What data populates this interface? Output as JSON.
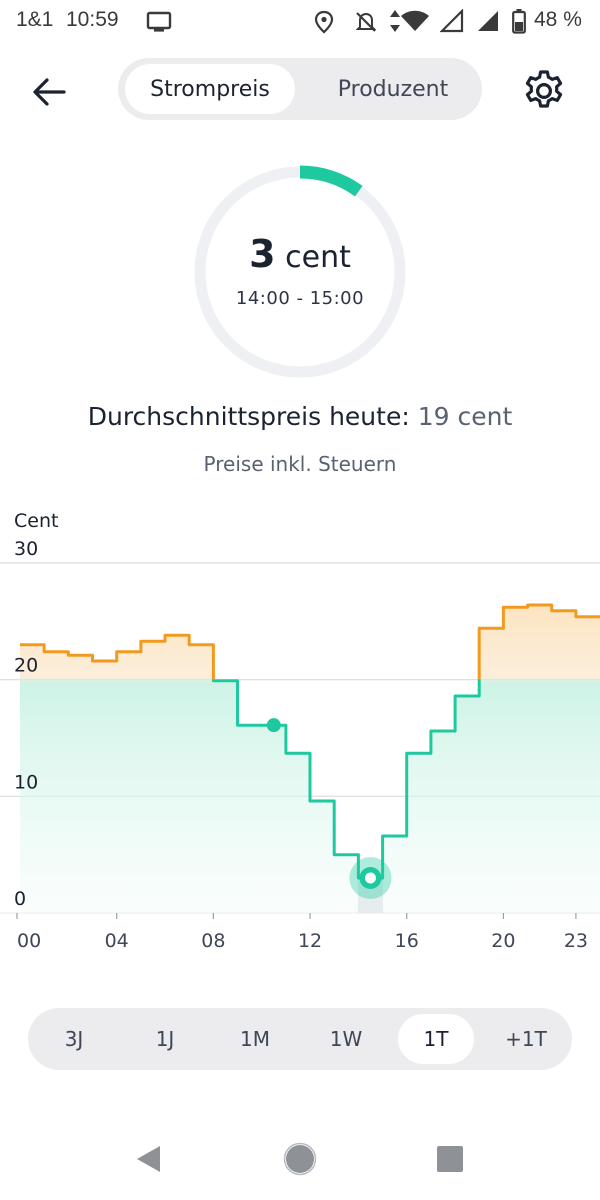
{
  "status_bar": {
    "carrier": "1&1",
    "time": "10:59",
    "battery": "48 %",
    "icons": [
      "screen-cast-icon",
      "location-icon",
      "notifications-off-icon",
      "data-arrows-icon",
      "wifi-icon",
      "signal-icon",
      "signal-icon",
      "battery-icon"
    ]
  },
  "header": {
    "back_icon": "back-arrow-icon",
    "tabs": [
      {
        "label": "Strompreis",
        "active": true
      },
      {
        "label": "Produzent",
        "active": false
      }
    ],
    "settings_icon": "gear-icon"
  },
  "gauge": {
    "value_number": "3",
    "value_unit": "cent",
    "time_range": "14:00 - 15:00",
    "level": 0.1
  },
  "summary": {
    "avg_label": "Durchschnittspreis heute:",
    "avg_value": "19 cent",
    "tax_note": "Preise inkl. Steuern"
  },
  "chart_data": {
    "type": "line",
    "ylabel": "Cent",
    "ylim": [
      0,
      30
    ],
    "yticks": [
      "0",
      "10",
      "20",
      "30"
    ],
    "xlim": [
      0,
      24
    ],
    "xticks": [
      {
        "h": 0,
        "label": "00"
      },
      {
        "h": 4,
        "label": "04"
      },
      {
        "h": 8,
        "label": "08"
      },
      {
        "h": 12,
        "label": "12"
      },
      {
        "h": 16,
        "label": "16"
      },
      {
        "h": 20,
        "label": "20"
      },
      {
        "h": 23,
        "label": "23"
      }
    ],
    "threshold": 20,
    "series": [
      {
        "x": [
          0,
          1,
          2,
          3,
          4,
          5,
          6,
          7,
          8,
          9,
          10,
          11,
          12,
          13,
          14,
          15,
          16,
          17,
          18,
          19,
          20,
          21,
          22,
          23
        ],
        "values": [
          23.0,
          22.4,
          22.1,
          21.6,
          22.4,
          23.3,
          23.8,
          23.0,
          19.9,
          16.1,
          16.1,
          13.7,
          9.6,
          5.0,
          3.0,
          6.6,
          13.7,
          15.6,
          18.6,
          24.4,
          26.2,
          26.4,
          25.9,
          25.4
        ]
      }
    ],
    "markers": [
      {
        "x": 10.5,
        "value": 16.1,
        "style": "dot"
      },
      {
        "x": 14.5,
        "value": 3.0,
        "style": "selected"
      }
    ],
    "colors": {
      "high": "#f29a1e",
      "low": "#1ec9a0",
      "grid": "#d9dce1"
    }
  },
  "time_ranges": {
    "items": [
      {
        "label": "3J",
        "active": false
      },
      {
        "label": "1J",
        "active": false
      },
      {
        "label": "1M",
        "active": false
      },
      {
        "label": "1W",
        "active": false
      },
      {
        "label": "1T",
        "active": true
      },
      {
        "label": "+1T",
        "active": false
      }
    ]
  },
  "nav_bar": {
    "icons": [
      "nav-back-icon",
      "nav-home-icon",
      "nav-recents-icon"
    ]
  }
}
